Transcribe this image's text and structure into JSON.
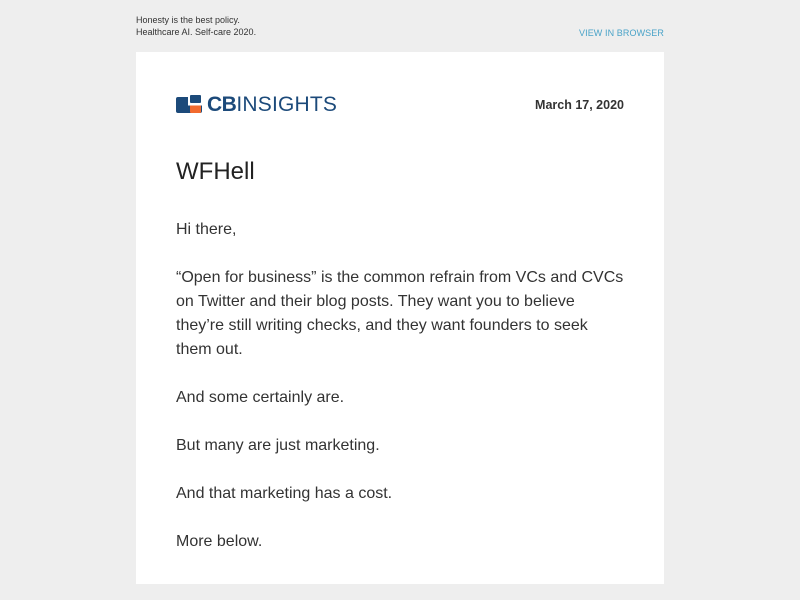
{
  "preheader": {
    "line1": "Honesty is the best policy.",
    "line2": "Healthcare AI. Self-care 2020.",
    "view_in_browser": "VIEW IN BROWSER"
  },
  "header": {
    "logo_cb": "CB",
    "logo_insights": "INSIGHTS",
    "date": "March 17, 2020"
  },
  "article": {
    "title": "WFHell",
    "paragraphs": [
      "Hi there,",
      "“Open for business” is the common refrain from VCs and CVCs on Twitter and their blog posts. They want you to believe they’re still writing checks, and they want founders to seek them out.",
      "And some certainly are.",
      "But many are just marketing.",
      "And that marketing has a cost.",
      "More below."
    ]
  },
  "colors": {
    "background": "#eeeeee",
    "card": "#ffffff",
    "brand_navy": "#1c4a7a",
    "brand_orange": "#f26a2e",
    "link": "#4aa3c8",
    "text": "#333333"
  }
}
